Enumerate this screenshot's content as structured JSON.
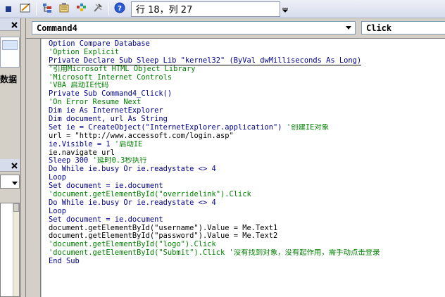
{
  "toolbar": {
    "status_text": "行 18，列 27"
  },
  "left_panel": {
    "label": "数据"
  },
  "code_window": {
    "object_combo": "Command4",
    "procedure_combo": "Click",
    "lines": [
      {
        "text": "Option Compare Database",
        "kind": "kw"
      },
      {
        "text": "'Option Explicit",
        "kind": "cm"
      },
      {
        "text": "Private Declare Sub Sleep Lib \"kernel32\" (ByVal dwMilliseconds As Long)",
        "kind": "kw",
        "underline": true
      },
      {
        "text": "'引用Microsoft HTML Object Library",
        "kind": "cm"
      },
      {
        "text": "'Microsoft Internet Controls",
        "kind": "cm"
      },
      {
        "text": "'VBA 启动IE代码",
        "kind": "cm"
      },
      {
        "text": "Private Sub Command4_Click()",
        "kind": "kw"
      },
      {
        "text": "'On Error Resume Next",
        "kind": "cm"
      },
      {
        "text": "Dim ie As InternetExplorer",
        "kind": "kw"
      },
      {
        "text": "Dim document, url As String",
        "kind": "kw"
      },
      {
        "text": "Set ie = CreateObject(\"InternetExplorer.application\") '创建IE对象",
        "kind": "mixed",
        "code": "Set ie = CreateObject(\"InternetExplorer.application\") ",
        "comment": "'创建IE对象"
      },
      {
        "text": "url = \"http://www.accessoft.com/login.asp\"",
        "kind": "plain"
      },
      {
        "text": "ie.Visible = 1 '启动IE",
        "kind": "mixed",
        "code": "ie.Visible = 1 ",
        "comment": "'启动IE"
      },
      {
        "text": "ie.navigate url",
        "kind": "plain"
      },
      {
        "text": "Sleep 300 '延时0.3秒执行",
        "kind": "mixed",
        "code": "Sleep 300 ",
        "comment": "'延时0.3秒执行"
      },
      {
        "text": "Do While ie.busy Or ie.readystate <> 4",
        "kind": "kw"
      },
      {
        "text": "Loop",
        "kind": "kw"
      },
      {
        "text": "Set document = ie.document",
        "kind": "kw"
      },
      {
        "text": "'document.getElementById(\"overridelink\").Click",
        "kind": "cm"
      },
      {
        "text": "Do While ie.busy Or ie.readystate <> 4",
        "kind": "kw"
      },
      {
        "text": "Loop",
        "kind": "kw"
      },
      {
        "text": "Set document = ie.document",
        "kind": "kw"
      },
      {
        "text": "document.getElementById(\"username\").Value = Me.Text1",
        "kind": "plain"
      },
      {
        "text": "document.getElementById(\"password\").Value = Me.Text2",
        "kind": "plain"
      },
      {
        "text": "'document.getElementById(\"logo\").Click",
        "kind": "cm"
      },
      {
        "text": "'document.getElementById(\"Submit\").Click '没有找到对象，没有起作用，需手动点击登录",
        "kind": "cm"
      },
      {
        "text": "End Sub",
        "kind": "kw"
      }
    ]
  },
  "colors": {
    "keyword": "#00008b",
    "comment": "#008000",
    "plain": "#000000"
  },
  "icons": [
    "close-icon",
    "stop-icon",
    "design-mode-icon",
    "project-explorer-icon",
    "properties-icon",
    "object-browser-icon",
    "toolbox-icon",
    "help-icon",
    "dropdown-arrow-icon"
  ]
}
